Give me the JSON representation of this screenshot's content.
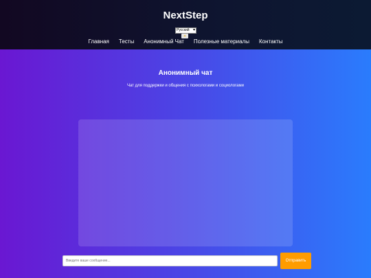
{
  "header": {
    "brand": "NextStep",
    "language_selected": "Русский",
    "theme_icon": "sun-icon",
    "nav": [
      {
        "label": "Главная"
      },
      {
        "label": "Тесты"
      },
      {
        "label": "Анонимный Чат"
      },
      {
        "label": "Полезные материалы"
      },
      {
        "label": "Контакты"
      }
    ]
  },
  "main": {
    "title": "Анонимный чат",
    "subtitle": "Чат для поддержки и общения с психологами и социологами"
  },
  "composer": {
    "placeholder": "Введите ваше сообщение...",
    "send_label": "Отправить"
  },
  "colors": {
    "header_bg": "#0e1530",
    "gradient_start": "#6a17d2",
    "gradient_end": "#2a7cfd",
    "send_button": "#ff9c00"
  }
}
